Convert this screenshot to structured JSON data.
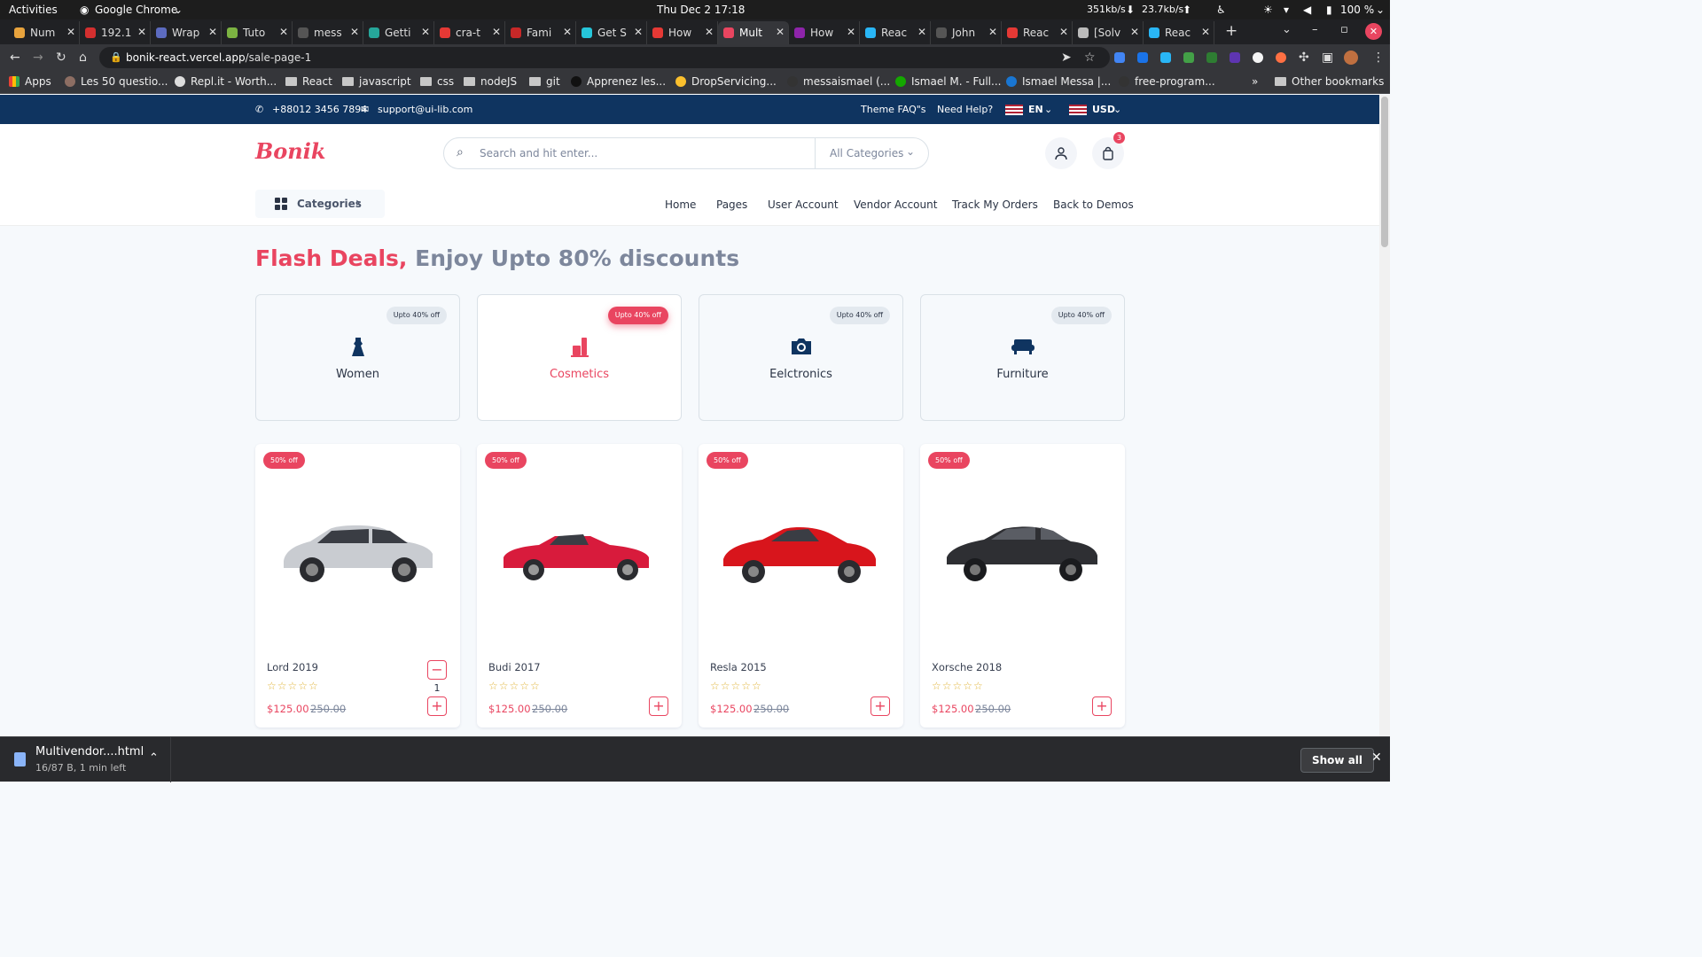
{
  "os": {
    "activities": "Activities",
    "app": "Google Chrome",
    "clock": "Thu Dec 2  17:18",
    "net_down": "351kb/s",
    "net_up": "23.7kb/s",
    "battery": "100 %"
  },
  "tabs": [
    {
      "label": "Num",
      "color": "#e8a33d"
    },
    {
      "label": "192.1",
      "color": "#d32f2f"
    },
    {
      "label": "Wrap",
      "color": "#5c6bc0"
    },
    {
      "label": "Tuto",
      "color": "#7cb342"
    },
    {
      "label": "mess",
      "color": "#555"
    },
    {
      "label": "Getti",
      "color": "#26a69a"
    },
    {
      "label": "cra-t",
      "color": "#e53935"
    },
    {
      "label": "Fami",
      "color": "#c62828"
    },
    {
      "label": "Get S",
      "color": "#26c6da"
    },
    {
      "label": "How",
      "color": "#e53935"
    },
    {
      "label": "Mult",
      "color": "#e94560"
    },
    {
      "label": "How",
      "color": "#8e24aa"
    },
    {
      "label": "Reac",
      "color": "#29b6f6"
    },
    {
      "label": "John",
      "color": "#555"
    },
    {
      "label": "Reac",
      "color": "#e53935"
    },
    {
      "label": "[Solv",
      "color": "#bbb"
    },
    {
      "label": "Reac",
      "color": "#29b6f6"
    }
  ],
  "address": {
    "host": "bonik-react.vercel.app",
    "path": "/sale-page-1"
  },
  "bookmarks": [
    {
      "label": "Apps",
      "type": "apps"
    },
    {
      "label": "Les 50 questio...",
      "type": "site",
      "color": "#8d6e63"
    },
    {
      "label": "Repl.it - Worth...",
      "type": "site",
      "color": "#ddd"
    },
    {
      "label": "React",
      "type": "folder"
    },
    {
      "label": "javascript",
      "type": "folder"
    },
    {
      "label": "css",
      "type": "folder"
    },
    {
      "label": "nodeJS",
      "type": "folder"
    },
    {
      "label": "git",
      "type": "folder"
    },
    {
      "label": "Apprenez les...",
      "type": "site",
      "color": "#111"
    },
    {
      "label": "DropServicing...",
      "type": "site",
      "color": "#fbc02d"
    },
    {
      "label": "messaismael (...",
      "type": "site",
      "color": "#333"
    },
    {
      "label": "Ismael M. - Full...",
      "type": "site",
      "color": "#14a800"
    },
    {
      "label": "Ismael Messa |...",
      "type": "site",
      "color": "#1976d2"
    },
    {
      "label": "free-program...",
      "type": "site",
      "color": "#333"
    }
  ],
  "other_bookmarks": "Other bookmarks",
  "site": {
    "phone": "+88012 3456 7894",
    "email": "support@ui-lib.com",
    "faq": "Theme FAQ\"s",
    "help": "Need Help?",
    "lang": "EN",
    "currency": "USD",
    "logo": "Bonik",
    "search_placeholder": "Search and hit enter...",
    "category_select": "All Categories",
    "cart_count": "3",
    "categories_button": "Categories",
    "nav": [
      "Home",
      "Pages",
      "User Account",
      "Vendor Account",
      "Track My Orders",
      "Back to Demos"
    ],
    "deal_title_a": "Flash Deals,",
    "deal_title_b": "Enjoy Upto 80% discounts",
    "cat_cards": [
      {
        "name": "Women",
        "badge": "Upto 40% off",
        "icon": "dress-icon"
      },
      {
        "name": "Cosmetics",
        "badge": "Upto 40% off",
        "icon": "cosmetics-icon"
      },
      {
        "name": "Eelctronics",
        "badge": "Upto 40% off",
        "icon": "camera-icon"
      },
      {
        "name": "Furniture",
        "badge": "Upto 40% off",
        "icon": "sofa-icon"
      }
    ],
    "products": [
      {
        "title": "Lord 2019",
        "off": "50% off",
        "price": "$125.00",
        "old_price": "250.00",
        "qty": "1",
        "car_color": "#c9ccd1"
      },
      {
        "title": "Budi 2017",
        "off": "50% off",
        "price": "$125.00",
        "old_price": "250.00",
        "qty": "",
        "car_color": "#d81b3c"
      },
      {
        "title": "Resla 2015",
        "off": "50% off",
        "price": "$125.00",
        "old_price": "250.00",
        "qty": "",
        "car_color": "#d8151c"
      },
      {
        "title": "Xorsche 2018",
        "off": "50% off",
        "price": "$125.00",
        "old_price": "250.00",
        "qty": "",
        "car_color": "#2e2f33"
      }
    ]
  },
  "download": {
    "file": "Multivendor....html",
    "status": "16/87 B, 1 min left",
    "show_all": "Show all"
  }
}
